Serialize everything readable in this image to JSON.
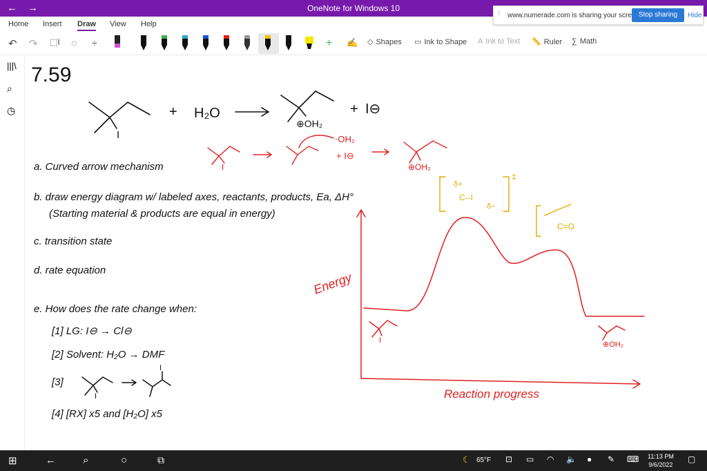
{
  "titlebar": {
    "title": "OneNote for Windows 10"
  },
  "menu": {
    "home": "Home",
    "insert": "Insert",
    "draw": "Draw",
    "view": "View",
    "help": "Help"
  },
  "toolbar": {
    "shapes": "Shapes",
    "ink_to_shape": "Ink to Shape",
    "ink_to_text": "Ink to Text",
    "ruler": "Ruler",
    "math": "Math"
  },
  "share_banner": {
    "message": "www.numerade.com is sharing your screen.",
    "stop_label": "Stop sharing",
    "hide_label": "Hide"
  },
  "notes": {
    "problem_number": "7.59",
    "reaction": {
      "plus1": "+",
      "water": "H₂O",
      "iodine_label": "I",
      "product_label": "⊕OH₂",
      "plus2": "+",
      "iodide": "I⊖"
    },
    "mech": {
      "i_label": "I",
      "oh2": "·OH₂",
      "iodide": "+ I⊖",
      "product_oh2": "⊕OH₂"
    },
    "questions": {
      "a": "a. Curved arrow mechanism",
      "b1": "b. draw energy diagram w/ labeled axes, reactants, products, Ea, ΔH°",
      "b2": "(Starting material & products are equal in energy)",
      "c": "c. transition state",
      "d": "d. rate equation",
      "e": "e. How does the rate change when:",
      "e1": "[1]  LG:  I⊖ → Cl⊖",
      "e2": "[2] Solvent:  H₂O → DMF",
      "e3": "[3]",
      "e3_i1": "I",
      "e3_i2": "I",
      "e4": "[4]   [RX] x5   and   [H₂O] x5"
    },
    "diagram": {
      "ylabel": "Energy",
      "xlabel": "Reaction progress",
      "ts_delta1": "δ+",
      "ts_delta2": "δ−",
      "ts_dagger": "‡",
      "ts_label": "C--I",
      "intermediate": "C=O",
      "reactant_i": "I",
      "product_oh2": "⊕OH₂"
    }
  },
  "taskbar": {
    "weather": "65°F",
    "time": "11:13 PM",
    "date": "9/6/2022"
  }
}
